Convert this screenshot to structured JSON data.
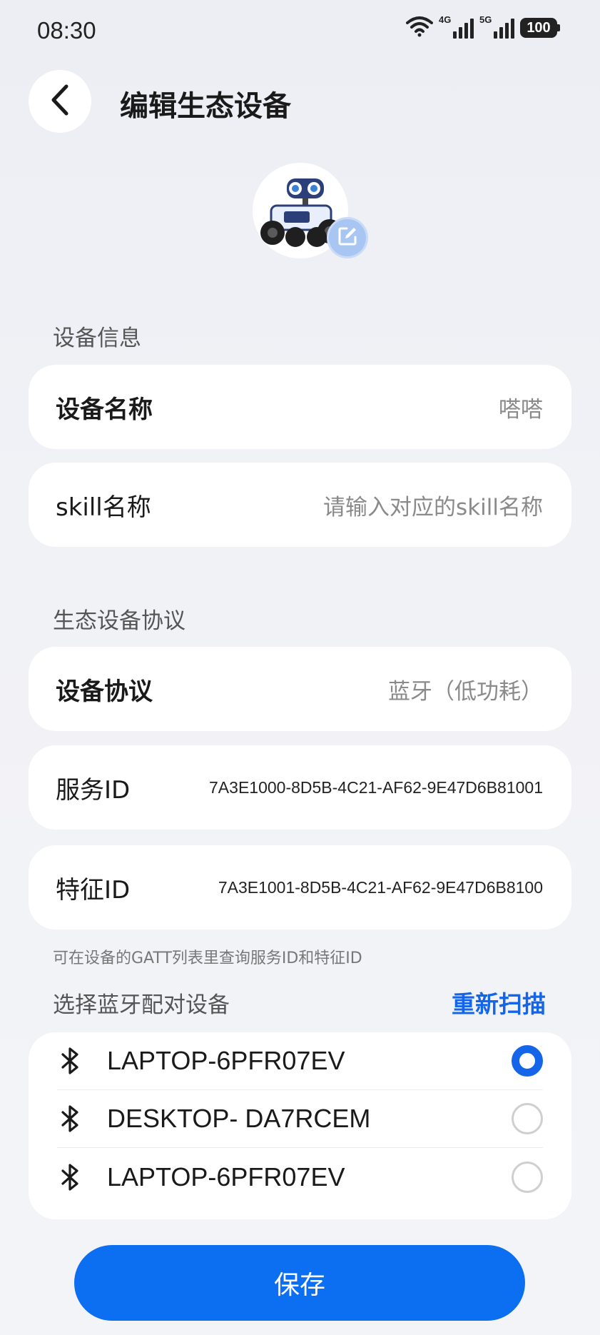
{
  "status_bar": {
    "time": "08:30",
    "network_1": "4G",
    "network_2": "5G",
    "battery": "100"
  },
  "header": {
    "title": "编辑生态设备"
  },
  "device_info": {
    "section_label": "设备信息",
    "name_label": "设备名称",
    "name_value": "嗒嗒",
    "skill_label": "skill名称",
    "skill_placeholder": "请输入对应的skill名称"
  },
  "protocol": {
    "section_label": "生态设备协议",
    "protocol_label": "设备协议",
    "protocol_value": "蓝牙（低功耗）",
    "service_id_label": "服务ID",
    "service_id_value": "7A3E1000-8D5B-4C21-AF62-9E47D6B81001",
    "char_id_label": "特征ID",
    "char_id_value": "7A3E1001-8D5B-4C21-AF62-9E47D6B8100",
    "hint": "可在设备的GATT列表里查询服务ID和特征ID"
  },
  "bluetooth": {
    "section_label": "选择蓝牙配对设备",
    "rescan_label": "重新扫描",
    "devices": [
      {
        "name": "LAPTOP-6PFR07EV",
        "selected": true
      },
      {
        "name": "DESKTOP- DA7RCEM",
        "selected": false
      },
      {
        "name": "LAPTOP-6PFR07EV",
        "selected": false
      }
    ]
  },
  "actions": {
    "save_label": "保存"
  },
  "colors": {
    "accent": "#1565e8",
    "save_button": "#0c6ef0",
    "background": "#eff0f5"
  }
}
